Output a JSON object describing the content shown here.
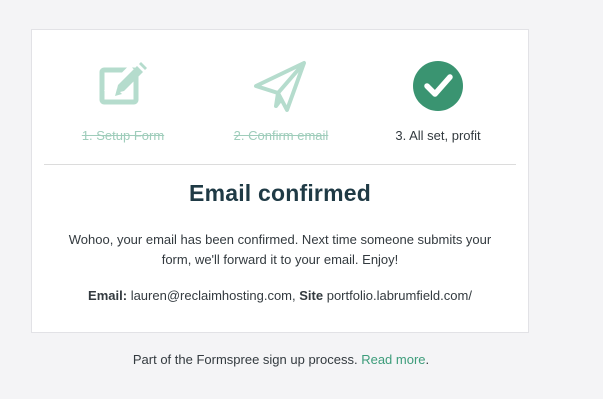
{
  "steps": [
    {
      "label": "1. Setup Form",
      "state": "done",
      "icon": "edit-icon"
    },
    {
      "label": "2. Confirm email",
      "state": "done",
      "icon": "paper-plane-icon"
    },
    {
      "label": "3. All set, profit",
      "state": "active",
      "icon": "checkmark-circle-icon"
    }
  ],
  "main": {
    "title": "Email confirmed",
    "message": "Wohoo, your email has been confirmed. Next time someone submits your form, we'll forward it to your email. Enjoy!",
    "email_label": "Email:",
    "email_value": "lauren@reclaimhosting.com,",
    "site_label": "Site",
    "site_value": "portfolio.labrumfield.com/"
  },
  "footer": {
    "text": "Part of the Formspree sign up process.",
    "link_label": "Read more",
    "suffix": "."
  },
  "colors": {
    "accent": "#3c9c7a",
    "muted_accent": "#9fcdbb",
    "heading": "#1f3a45",
    "background": "#f4f4f6"
  }
}
